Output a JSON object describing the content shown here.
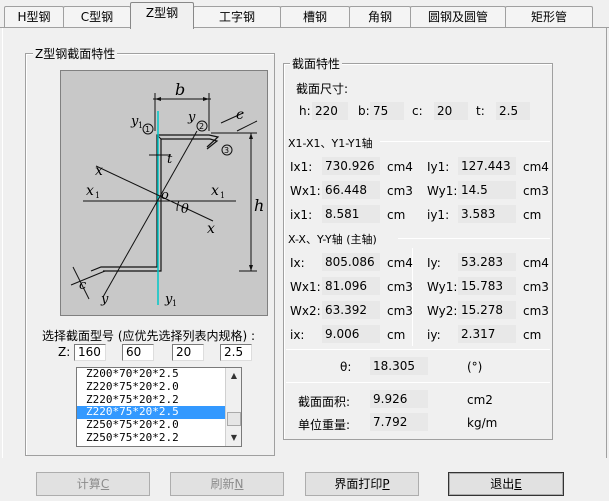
{
  "tabs": [
    {
      "label": "H型钢"
    },
    {
      "label": "C型钢"
    },
    {
      "label": "Z型钢"
    },
    {
      "label": "工字钢"
    },
    {
      "label": "槽钢"
    },
    {
      "label": "角钢"
    },
    {
      "label": "圆钢及圆管"
    },
    {
      "label": "矩形管"
    }
  ],
  "left_group": {
    "title": "Z型钢截面特性",
    "diagram": {
      "b": "b",
      "c": "c",
      "h": "h",
      "t": "t",
      "x": "x",
      "x1": "x",
      "y": "y",
      "y1": "y",
      "sub1": "1",
      "o": "o",
      "theta": "θ",
      "circle1": "1",
      "circle2": "2",
      "circle3": "3"
    },
    "select_label": "选择截面型号 (应优先选择列表内规格) :",
    "z_label": "Z:",
    "inputs": {
      "h": "160",
      "b": "60",
      "c": "20",
      "t": "2.5"
    },
    "list": [
      "Z200*70*20*2.5",
      "Z220*75*20*2.0",
      "Z220*75*20*2.2",
      "Z220*75*20*2.5",
      "Z250*75*20*2.0",
      "Z250*75*20*2.2"
    ],
    "list_selected_index": 3
  },
  "right_group": {
    "title": "截面特性",
    "dims_label": "截面尺寸:",
    "dims": {
      "h_label": "h:",
      "h": "220",
      "b_label": "b:",
      "b": "75",
      "c_label": "c:",
      "c": "20",
      "t_label": "t:",
      "t": "2.5"
    },
    "x1y1_title": "X1-X1、Y1-Y1轴",
    "x1y1": {
      "Ix1_label": "Ix1:",
      "Ix1": "730.926",
      "Ix1_unit": "cm4",
      "Iy1_label": "Iy1:",
      "Iy1": "127.443",
      "Iy1_unit": "cm4",
      "Wx1_label": "Wx1:",
      "Wx1": "66.448",
      "Wx1_unit": "cm3",
      "Wy1_label": "Wy1:",
      "Wy1": "14.5",
      "Wy1_unit": "cm3",
      "ix1_label": "ix1:",
      "ix1": "8.581",
      "ix1_unit": "cm",
      "iy1_label": "iy1:",
      "iy1": "3.583",
      "iy1_unit": "cm"
    },
    "xy_title": "X-X、Y-Y轴 (主轴)",
    "xy": {
      "Ix_label": "Ix:",
      "Ix": "805.086",
      "Ix_unit": "cm4",
      "Iy_label": "Iy:",
      "Iy": "53.283",
      "Iy_unit": "cm4",
      "Wx1_label": "Wx1:",
      "Wx1": "81.096",
      "Wx1_unit": "cm3",
      "Wy1_label": "Wy1:",
      "Wy1": "15.783",
      "Wy1_unit": "cm3",
      "Wx2_label": "Wx2:",
      "Wx2": "63.392",
      "Wx2_unit": "cm3",
      "Wy2_label": "Wy2:",
      "Wy2": "15.278",
      "Wy2_unit": "cm3",
      "ix_label": "ix:",
      "ix": "9.006",
      "ix_unit": "cm",
      "iy_label": "iy:",
      "iy": "2.317",
      "iy_unit": "cm"
    },
    "theta_label": "θ:",
    "theta": "18.305",
    "theta_unit": "(°)",
    "area_label": "截面面积:",
    "area": "9.926",
    "area_unit": "cm2",
    "weight_label": "单位重量:",
    "weight": "7.792",
    "weight_unit": "kg/m"
  },
  "buttons": {
    "calc": {
      "text": "计算",
      "key": "C"
    },
    "refresh": {
      "text": "刷新",
      "key": "N"
    },
    "print": {
      "text": "界面打印",
      "key": "P"
    },
    "exit": {
      "text": "退出",
      "key": "E"
    }
  },
  "colors": {
    "selection": "#3399ff",
    "diagram_bg": "#c8c8c8",
    "section_line": "#00c8c8"
  }
}
